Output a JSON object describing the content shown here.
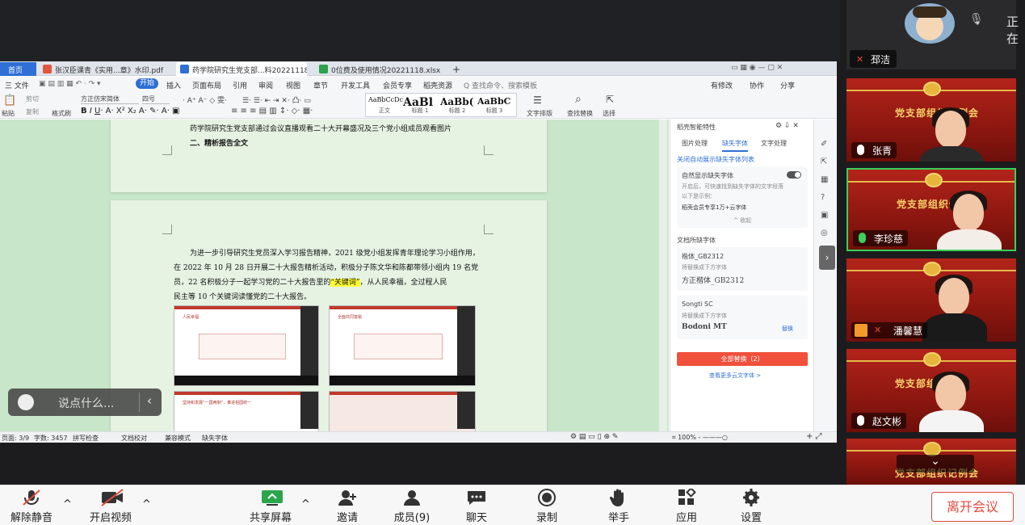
{
  "meeting": {
    "top_user": "邳洁",
    "top_status": "正在",
    "chat_placeholder": "说点什么...",
    "leave_label": "离开会议"
  },
  "wps": {
    "tabs": [
      {
        "label": "首页"
      },
      {
        "label": "张汉臣课青《实用...章》水印.pdf"
      },
      {
        "label": "药学院研究生党支部...料20221118"
      },
      {
        "label": "0位费及使用情况20221118.xlsx"
      }
    ],
    "menu": [
      "三 文件",
      "开始",
      "插入",
      "页面布局",
      "引用",
      "审阅",
      "视图",
      "章节",
      "开发工具",
      "会员专享",
      "稻壳资源",
      "Q 查找命令、搜索模板"
    ],
    "menu_right": [
      "有修改",
      "协作",
      "分享"
    ],
    "toolbar": {
      "paste": "粘贴",
      "cut": "剪切",
      "copy": "复制",
      "format_painter": "格式刷",
      "font": "方正仿宋简体",
      "size": "四号",
      "styles": [
        {
          "preview": "AaBbCcDc",
          "name": "正文"
        },
        {
          "preview": "AaBl",
          "name": "标题 1"
        },
        {
          "preview": "AaBb(",
          "name": "标题 2"
        },
        {
          "preview": "AaBbC",
          "name": "标题 3"
        }
      ],
      "text_layout": "文字排版",
      "find_replace": "查找替换",
      "select": "选择"
    },
    "document": {
      "page1_line1": "药学院研究生党支部通过会议直播观看二十大开幕盛况及三个党小组成员观看图片",
      "page1_heading": "二、精析报告全文",
      "para_lines": [
        "为进一步引导研究生党员深入学习报告精神，2021 级党小组发挥青年理论学习小组作用，",
        "在 2022 年 10 月 28 日开展二十大报告精析活动，积极分子陈文华和陈都带领小组内 19 名党",
        "员，22 名积极分子一起学习党的二十大报告里的",
        "民主等 10 个关键词读懂党的二十大报告。"
      ],
      "highlight": "“关键词”",
      "para_line3_tail": "，从人民幸福，全过程人民",
      "thumb_caps": [
        "人民幸福",
        "全面共同富裕",
        "坚持和发展“一国两制”，推进祖国统一",
        ""
      ]
    },
    "panel": {
      "title": "稻壳智能特性",
      "tabs": [
        "图片处理",
        "缺失字体",
        "文字处理"
      ],
      "link_close": "关闭自动展示缺失字体列表",
      "toggle_label": "自然显示缺失字体",
      "hint": "开启后，可快速找到缺失字体的文字段落",
      "example": "以下是示例：",
      "example_text": "稻壳会员专享1万+云字体",
      "collapse": "收起",
      "section": "文档所缺字体",
      "fonts": [
        {
          "missing": "楷体_GB2312",
          "note": "将替换成下方字体",
          "replace": "方正楷体_GB2312",
          "action": ""
        },
        {
          "missing": "Songti SC",
          "note": "将替换成下方字体",
          "replace": "Bodoni MT",
          "action": "替换"
        }
      ],
      "replace_all": "全部替换（2）",
      "more": "查看更多云文字体 >"
    },
    "status": {
      "page": "页面: 3/9",
      "words": "字数: 3457",
      "spell": "拼写检查",
      "proof": "文档校对",
      "compat": "兼容模式",
      "missing_font": "缺失字体",
      "zoom": "100%"
    }
  },
  "participants": [
    {
      "name": "张青",
      "banner": "党支部组织记例会"
    },
    {
      "name": "李珍慈",
      "banner": "党支部组织例会"
    },
    {
      "name": "潘馨慧",
      "banner": ""
    },
    {
      "name": "赵文彬",
      "banner": "党支部组织例会"
    },
    {
      "name": "",
      "banner": "党支部组织记例会"
    }
  ],
  "bottom_bar": [
    {
      "label": "解除静音",
      "icon": "mic-muted-icon"
    },
    {
      "label": "开启视频",
      "icon": "video-off-icon"
    },
    {
      "label": "共享屏幕",
      "icon": "share-screen-icon"
    },
    {
      "label": "邀请",
      "icon": "invite-icon"
    },
    {
      "label": "成员(9)",
      "icon": "members-icon"
    },
    {
      "label": "聊天",
      "icon": "chat-icon"
    },
    {
      "label": "录制",
      "icon": "record-icon"
    },
    {
      "label": "举手",
      "icon": "raise-hand-icon"
    },
    {
      "label": "应用",
      "icon": "apps-icon"
    },
    {
      "label": "设置",
      "icon": "settings-icon"
    }
  ],
  "colors": {
    "accent": "#2f6fd6",
    "danger": "#e04b3d",
    "doc_bg": "#c8e6c9"
  }
}
